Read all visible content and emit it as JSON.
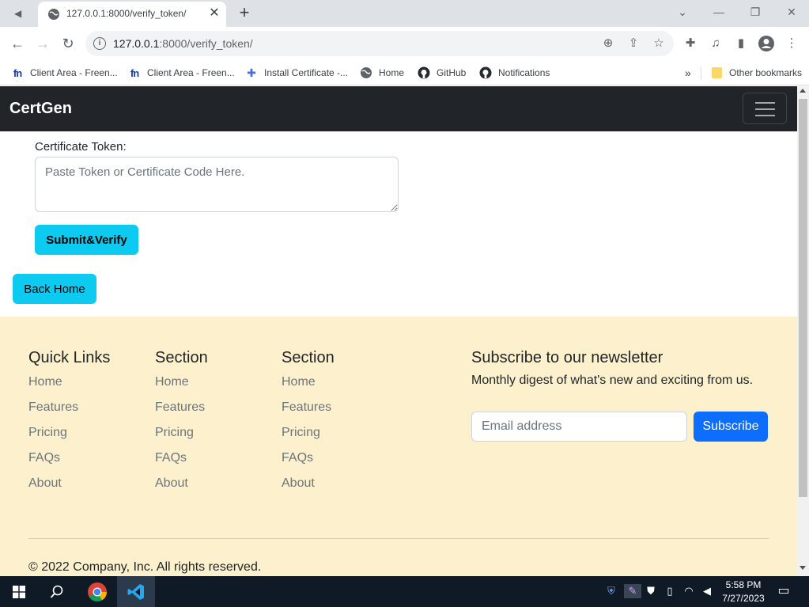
{
  "browser": {
    "tab_title": "127.0.0.1:8000/verify_token/",
    "url_host": "127.0.0.1",
    "url_path": ":8000/verify_token/",
    "bookmarks": [
      {
        "label": "Client Area - Freen...",
        "icon": "freenom-icon"
      },
      {
        "label": "Client Area - Freen...",
        "icon": "freenom-icon"
      },
      {
        "label": "Install Certificate -...",
        "icon": "puzzle-icon"
      },
      {
        "label": "Home",
        "icon": "globe-icon"
      },
      {
        "label": "GitHub",
        "icon": "github-icon"
      },
      {
        "label": "Notifications",
        "icon": "github-icon"
      }
    ],
    "other_bookmarks": "Other bookmarks",
    "overflow": "»"
  },
  "navbar": {
    "brand": "CertGen"
  },
  "form": {
    "label": "Certificate Token:",
    "placeholder": "Paste Token or Certificate Code Here.",
    "submit_label": "Submit&Verify",
    "back_label": "Back Home"
  },
  "footer": {
    "columns": [
      {
        "title": "Quick Links",
        "links": [
          "Home",
          "Features",
          "Pricing",
          "FAQs",
          "About"
        ]
      },
      {
        "title": "Section",
        "links": [
          "Home",
          "Features",
          "Pricing",
          "FAQs",
          "About"
        ]
      },
      {
        "title": "Section",
        "links": [
          "Home",
          "Features",
          "Pricing",
          "FAQs",
          "About"
        ]
      }
    ],
    "newsletter_title": "Subscribe to our newsletter",
    "newsletter_text": "Monthly digest of what's new and exciting from us.",
    "email_placeholder": "Email address",
    "subscribe_label": "Subscribe",
    "copyright": "© 2022 Company, Inc. All rights reserved."
  },
  "taskbar": {
    "time": "5:58 PM",
    "date": "7/27/2023"
  },
  "colors": {
    "navbar": "#212529",
    "info_button": "#0dcaf0",
    "primary_button": "#0d6efd",
    "footer_bg": "#fdf0cc"
  }
}
